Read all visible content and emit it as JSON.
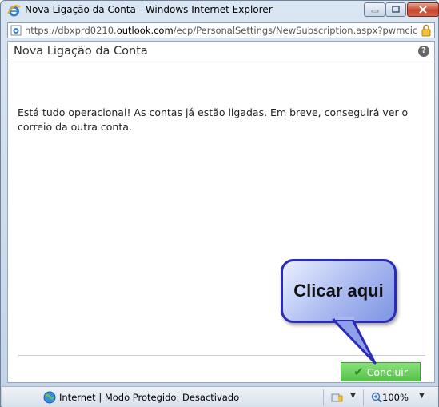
{
  "window": {
    "title": "Nova Ligação da Conta - Windows Internet Explorer",
    "url_prefix": "https://dbxprd0210.",
    "url_domain": "outlook.com",
    "url_suffix": "/ecp/PersonalSettings/NewSubscription.aspx?pwmcic"
  },
  "page": {
    "title": "Nova Ligação da Conta",
    "help_label": "?",
    "message": "Está tudo operacional! As contas já estão ligadas. Em breve, conseguirá ver o correio da outra conta.",
    "done_label": "Concluir"
  },
  "callout": {
    "text": "Clicar aqui"
  },
  "statusbar": {
    "zone_text": "Internet | Modo Protegido: Desactivado",
    "zoom": "100%"
  },
  "colors": {
    "accent_button": "#55c24a",
    "callout_border": "#2b2bb8",
    "close_button": "#c6452d"
  }
}
